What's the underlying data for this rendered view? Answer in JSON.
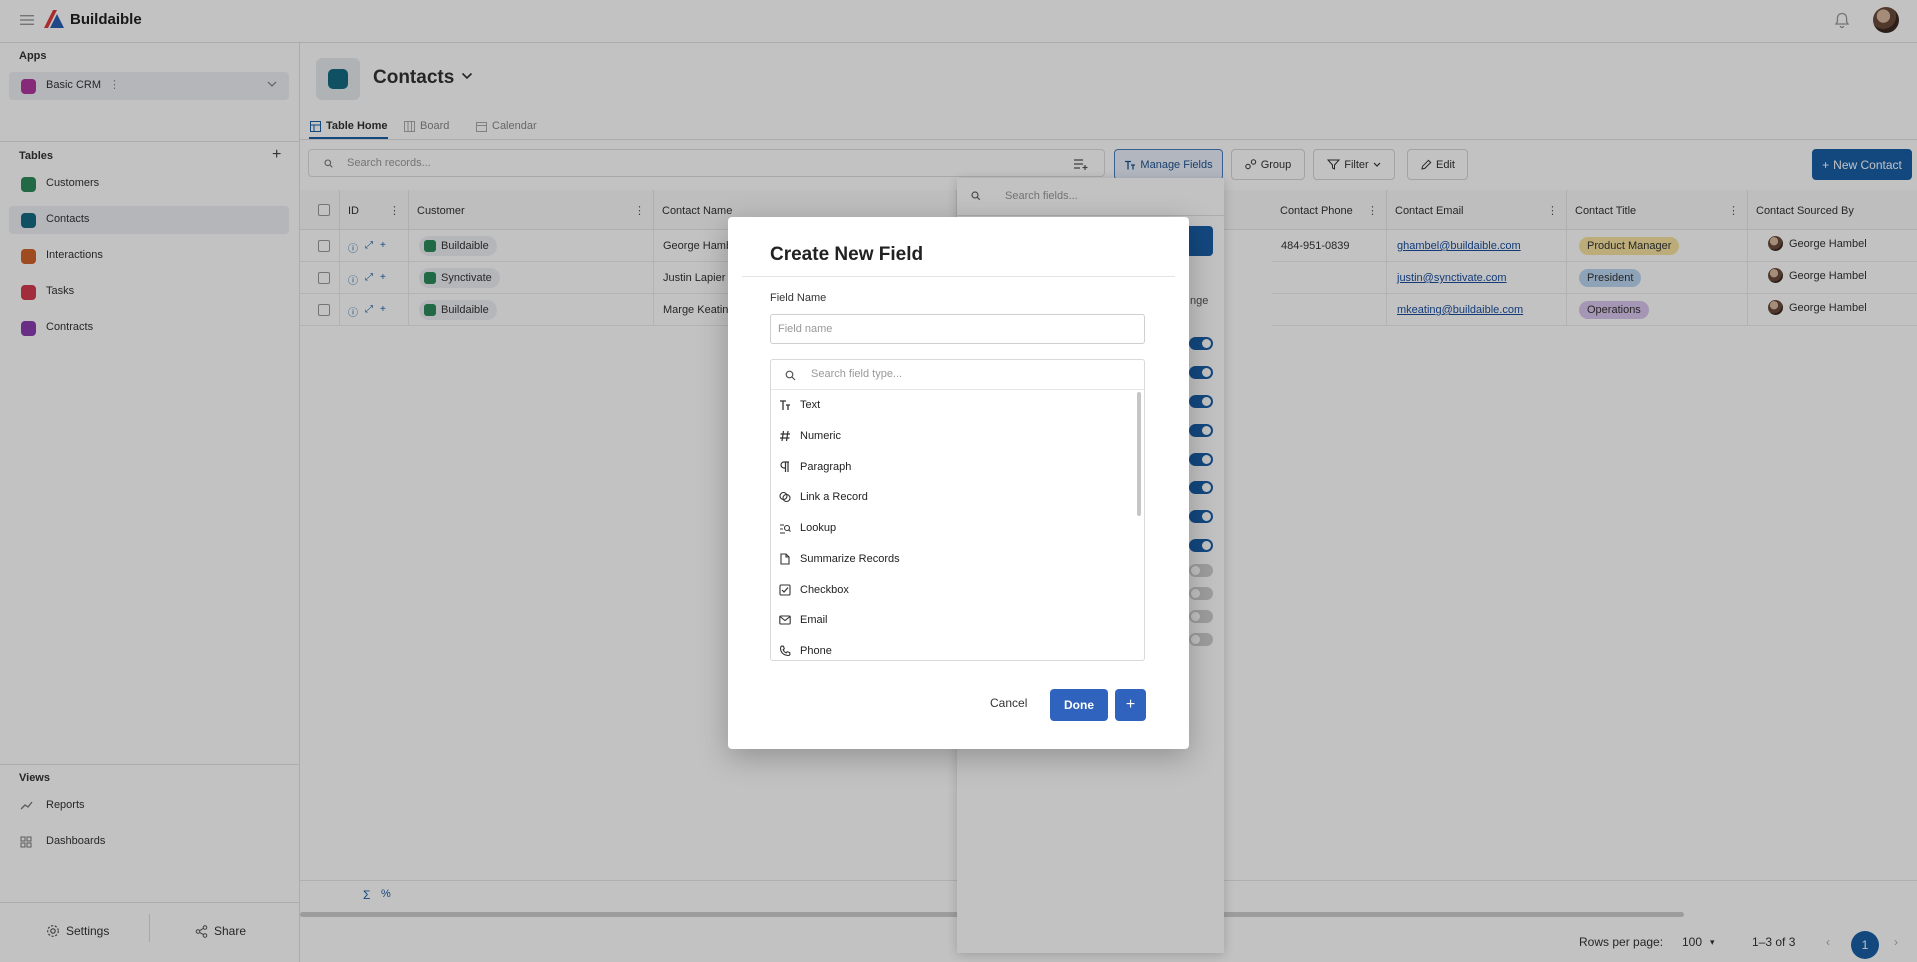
{
  "topbar": {
    "brand": "Buildaible"
  },
  "sidebar": {
    "apps_title": "Apps",
    "app": {
      "label": "Basic CRM",
      "menu": "⋮",
      "color": "#b0379e"
    },
    "tables_title": "Tables",
    "tables": [
      {
        "label": "Customers",
        "color": "#2d8a5b",
        "active": false
      },
      {
        "label": "Contacts",
        "color": "#156b83",
        "active": true
      },
      {
        "label": "Interactions",
        "color": "#d2622a",
        "active": false
      },
      {
        "label": "Tasks",
        "color": "#d43a4f",
        "active": false
      },
      {
        "label": "Contracts",
        "color": "#8a3fb0",
        "active": false
      }
    ],
    "views_title": "Views",
    "views": [
      {
        "label": "Reports",
        "icon": "chart-line-icon"
      },
      {
        "label": "Dashboards",
        "icon": "grid-icon"
      }
    ],
    "settings_label": "Settings",
    "share_label": "Share"
  },
  "main": {
    "title": "Contacts",
    "tabs": [
      {
        "label": "Table Home",
        "active": true
      },
      {
        "label": "Board",
        "active": false
      },
      {
        "label": "Calendar",
        "active": false
      }
    ],
    "search_placeholder": "Search records...",
    "toolbar": {
      "manage_fields": "Manage Fields",
      "group": "Group",
      "filter": "Filter",
      "edit": "Edit",
      "new_contact": "New Contact"
    },
    "columns": {
      "id": "ID",
      "customer": "Customer",
      "contact_name": "Contact Name",
      "contact_phone": "Contact Phone",
      "contact_email": "Contact Email",
      "contact_title": "Contact Title",
      "sourced_by": "Contact Sourced By"
    },
    "rows": [
      {
        "customer": "Buildaible",
        "name": "George Hamb",
        "phone": "484-951-0839",
        "email": "ghambel@buildaible.com",
        "title": "Product Manager",
        "title_color": "#f6e3a1",
        "sourced_by": "George Hambel"
      },
      {
        "customer": "Synctivate",
        "name": "Justin Lapier",
        "phone": "",
        "email": "justin@synctivate.com",
        "title": "President",
        "title_color": "#bcd7f2",
        "sourced_by": "George Hambel"
      },
      {
        "customer": "Buildaible",
        "name": "Marge Keatin",
        "phone": "",
        "email": "mkeating@buildaible.com",
        "title": "Operations",
        "title_color": "#d9c6ee",
        "sourced_by": "George Hambel"
      }
    ],
    "footer_icons": [
      "sigma-icon",
      "percent-icon"
    ],
    "pagination": {
      "rows_per_page_label": "Rows per page:",
      "rows_per_page": "100",
      "range": "1–3 of 3",
      "page": "1"
    }
  },
  "manage_fields_panel": {
    "search_placeholder": "Search fields...",
    "partial_text": "nge",
    "toggles": [
      true,
      true,
      true,
      true,
      true,
      true,
      true,
      true,
      false,
      false,
      false,
      false
    ]
  },
  "modal": {
    "title": "Create New Field",
    "field_name_label": "Field Name",
    "field_name_placeholder": "Field name",
    "field_name_value": "",
    "type_search_placeholder": "Search field type...",
    "types": [
      {
        "label": "Text",
        "icon": "text-icon"
      },
      {
        "label": "Numeric",
        "icon": "hash-icon"
      },
      {
        "label": "Paragraph",
        "icon": "paragraph-icon"
      },
      {
        "label": "Link a Record",
        "icon": "link-icon"
      },
      {
        "label": "Lookup",
        "icon": "lookup-icon"
      },
      {
        "label": "Summarize Records",
        "icon": "document-icon"
      },
      {
        "label": "Checkbox",
        "icon": "checkbox-icon"
      },
      {
        "label": "Email",
        "icon": "mail-icon"
      },
      {
        "label": "Phone",
        "icon": "phone-icon"
      }
    ],
    "cancel_label": "Cancel",
    "done_label": "Done",
    "add_label": "+"
  },
  "colors": {
    "accent": "#1a5fa8",
    "done_button": "#2f63bd"
  }
}
